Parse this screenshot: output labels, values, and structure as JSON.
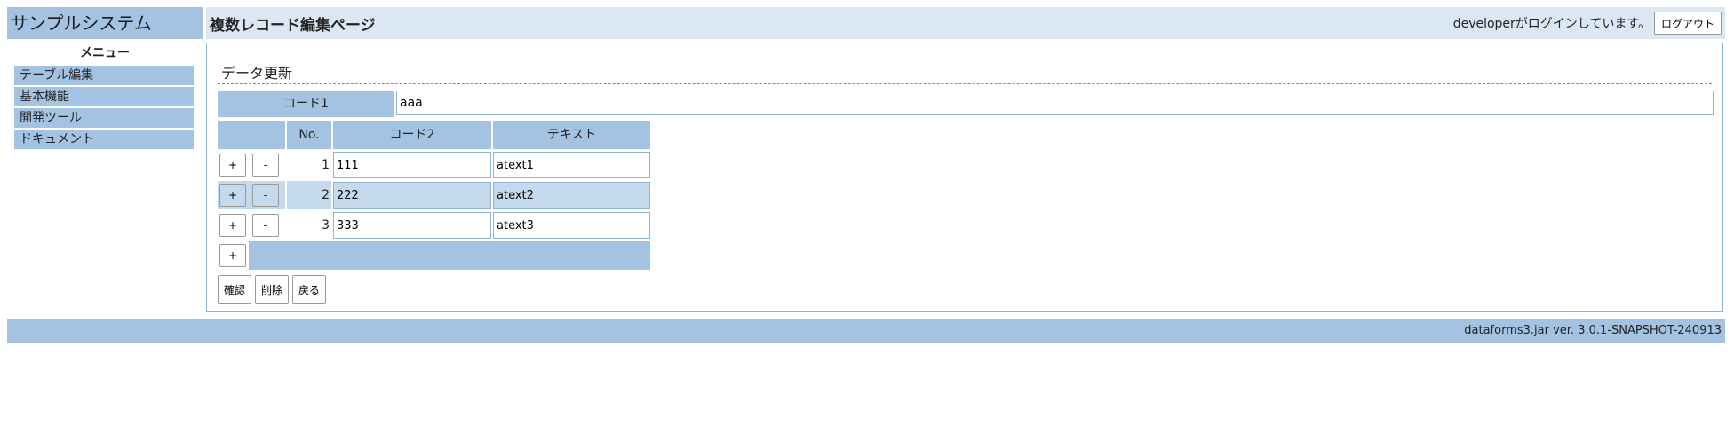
{
  "app_title": "サンプルシステム",
  "header": {
    "page_title": "複数レコード編集ページ",
    "login_message": "developerがログインしています。",
    "logout_label": "ログアウト"
  },
  "sidebar": {
    "menu_title": "メニュー",
    "items": [
      {
        "label": "テーブル編集"
      },
      {
        "label": "基本機能"
      },
      {
        "label": "開発ツール"
      },
      {
        "label": "ドキュメント"
      }
    ]
  },
  "main": {
    "section_title": "データ更新",
    "code1": {
      "label": "コード1",
      "value": "aaa"
    },
    "table": {
      "headers": {
        "no": "No.",
        "code2": "コード2",
        "text": "テキスト"
      },
      "add_label": "+",
      "remove_label": "-",
      "rows": [
        {
          "no": "1",
          "code2": "111",
          "text": "atext1"
        },
        {
          "no": "2",
          "code2": "222",
          "text": "atext2"
        },
        {
          "no": "3",
          "code2": "333",
          "text": "atext3"
        }
      ]
    },
    "actions": {
      "confirm": "確認",
      "delete": "削除",
      "back": "戻る"
    }
  },
  "footer": {
    "version": "dataforms3.jar ver. 3.0.1-SNAPSHOT-240913"
  }
}
